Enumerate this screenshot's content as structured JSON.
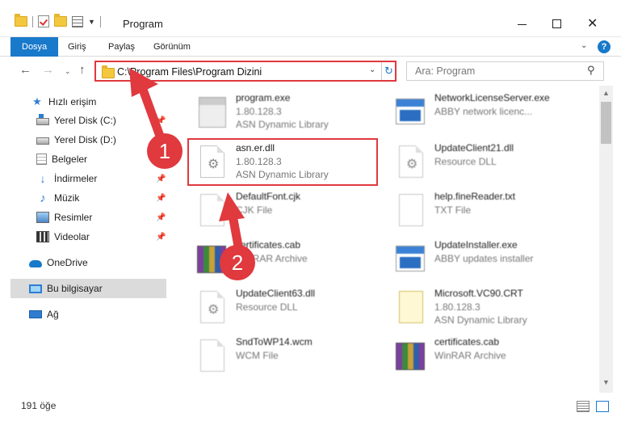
{
  "window": {
    "title": "Program",
    "controls": {
      "minimize": "—",
      "maximize": "",
      "close": "✕"
    }
  },
  "ribbon": {
    "tabs": [
      "Dosya",
      "Giriş",
      "Paylaş",
      "Görünüm"
    ],
    "help": "?"
  },
  "address": {
    "path": "C:\\Program Files\\Program Dizini",
    "search_placeholder": "Ara: Program"
  },
  "sidebar": {
    "items": [
      {
        "label": "Hızlı erişim",
        "icon": "star-icon"
      },
      {
        "label": "Yerel Disk (C:)",
        "icon": "drive-icon"
      },
      {
        "label": "Yerel Disk (D:)",
        "icon": "drive-icon"
      },
      {
        "label": "Belgeler",
        "icon": "documents-icon"
      },
      {
        "label": "İndirmeler",
        "icon": "download-icon"
      },
      {
        "label": "Müzik",
        "icon": "music-icon"
      },
      {
        "label": "Resimler",
        "icon": "pictures-icon"
      },
      {
        "label": "Videolar",
        "icon": "videos-icon"
      },
      {
        "label": "OneDrive",
        "icon": "cloud-icon"
      },
      {
        "label": "Bu bilgisayar",
        "icon": "computer-icon"
      },
      {
        "label": "Ağ",
        "icon": "network-icon"
      }
    ]
  },
  "files": [
    {
      "name": "program.exe",
      "line2": "1.80.128.3",
      "line3": "ASN Dynamic Library",
      "icon": "exe-icon"
    },
    {
      "name": "NetworkLicenseServer.exe",
      "line2": "ABBY network licenc...",
      "line3": "",
      "icon": "app-icon"
    },
    {
      "name": "asn.er.dll",
      "line2": "1.80.128.3",
      "line3": "ASN Dynamic Library",
      "icon": "dll-icon"
    },
    {
      "name": "UpdateClient21.dll",
      "line2": "Resource DLL",
      "line3": "",
      "icon": "dll-icon"
    },
    {
      "name": "DefaultFont.cjk",
      "line2": "CJK File",
      "line3": "",
      "icon": "file-icon"
    },
    {
      "name": "help.fineReader.txt",
      "line2": "TXT File",
      "line3": "",
      "icon": "txt-icon"
    },
    {
      "name": "certificates.cab",
      "line2": "WinRAR Archive",
      "line3": "",
      "icon": "rar-icon"
    },
    {
      "name": "UpdateInstaller.exe",
      "line2": "ABBY updates installer",
      "line3": "",
      "icon": "app-icon"
    },
    {
      "name": "UpdateClient63.dll",
      "line2": "Resource DLL",
      "line3": "",
      "icon": "dll-icon"
    },
    {
      "name": "Microsoft.VC90.CRT",
      "line2": "1.80.128.3",
      "line3": "ASN Dynamic Library",
      "icon": "cert-icon"
    },
    {
      "name": "SndToWP14.wcm",
      "line2": "WCM File",
      "line3": "",
      "icon": "file-icon"
    },
    {
      "name": "certificates.cab",
      "line2": "WinRAR Archive",
      "line3": "",
      "icon": "rar-icon"
    }
  ],
  "status": {
    "count": "191 öğe"
  },
  "annotations": {
    "badge1": "1",
    "badge2": "2"
  },
  "colors": {
    "accent": "#1979ca",
    "annotation": "#e0393e"
  }
}
